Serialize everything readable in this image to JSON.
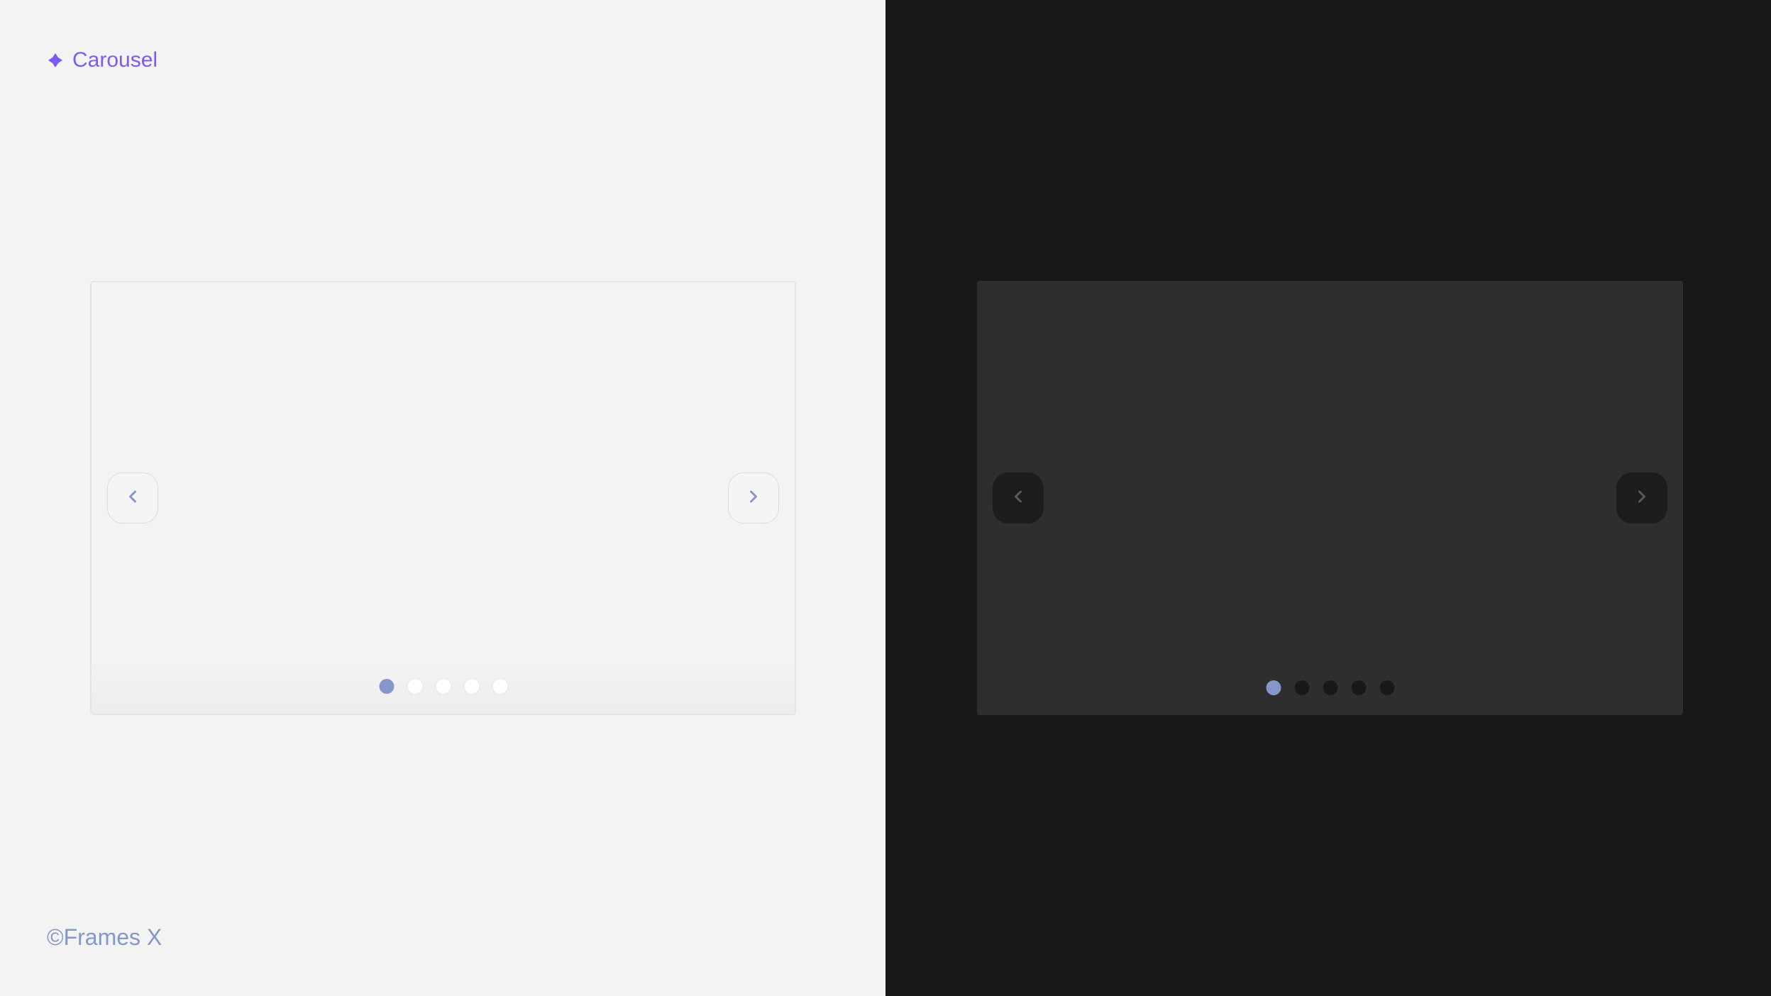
{
  "header": {
    "title": "Carousel"
  },
  "footer": {
    "copyright": "©Frames X"
  },
  "carousel": {
    "total_slides": 5,
    "active_slide": 1
  },
  "colors": {
    "accent": "#7c5cf0",
    "indicator_active": "#8596c9",
    "light_bg": "#f3f3f3",
    "dark_bg": "#1a1817",
    "dark_carousel_bg": "#2e2e2e"
  }
}
